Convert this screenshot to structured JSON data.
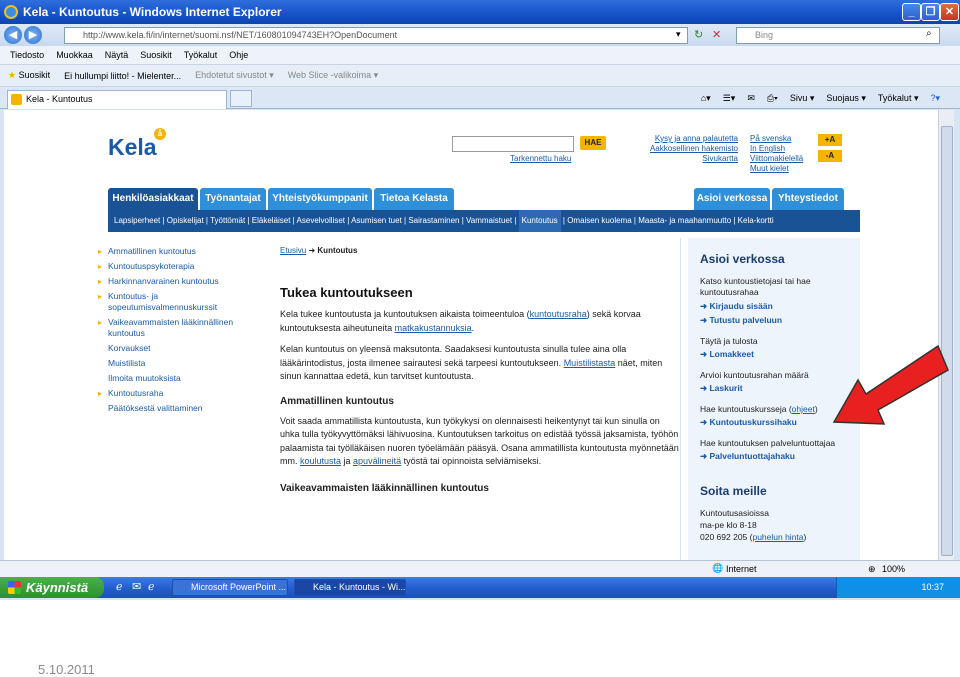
{
  "window": {
    "title": "Kela - Kuntoutus - Windows Internet Explorer",
    "url": "http://www.kela.fi/in/internet/suomi.nsf/NET/160801094743EH?OpenDocument",
    "search_placeholder": "Bing"
  },
  "menubar": [
    "Tiedosto",
    "Muokkaa",
    "Näytä",
    "Suosikit",
    "Työkalut",
    "Ohje"
  ],
  "favbar": {
    "favorites": "Suosikit",
    "items": [
      "Ei hullumpi liitto! - Mielenter...",
      "Ehdotetut sivustot ▾",
      "Web Slice -valikoima ▾"
    ]
  },
  "tab": {
    "title": "Kela - Kuntoutus"
  },
  "commandbar": [
    "Sivu ▾",
    "Suojaus ▾",
    "Työkalut ▾"
  ],
  "site": {
    "logo": "Kela",
    "logo_badge": "å",
    "search_button": "HAE",
    "advanced_search": "Tarkennettu haku",
    "quick_links": [
      "Kysy ja anna palautetta",
      "Aakkosellinen hakemisto",
      "Sivukartta"
    ],
    "lang_links": [
      "På svenska",
      "In English",
      "Viittomakielellä",
      "Muut kielet"
    ],
    "font_larger": "+A",
    "font_smaller": "-A",
    "main_tabs": [
      "Henkilöasiakkaat",
      "Työnantajat",
      "Yhteistyökumppanit",
      "Tietoa Kelasta",
      "Asioi verkossa",
      "Yhteystiedot"
    ],
    "nav_items": [
      "Lapsiperheet",
      "Opiskelijat",
      "Työttömät",
      "Eläkeläiset",
      "Asevelvolliset",
      "Asumisen tuet",
      "Sairastaminen",
      "Vammaistuet",
      "Kuntoutus",
      "Omaisen kuolema",
      "Maasta- ja maahanmuutto",
      "Kela-kortti"
    ],
    "left_nav": [
      {
        "label": "Ammatillinen kuntoutus",
        "bullet": true
      },
      {
        "label": "Kuntoutuspsykoterapia",
        "bullet": true
      },
      {
        "label": "Harkinnanvarainen kuntoutus",
        "bullet": true
      },
      {
        "label": "Kuntoutus- ja sopeutumisvalmennuskurssit",
        "bullet": true
      },
      {
        "label": "Vaikeavammaisten lääkinnällinen kuntoutus",
        "bullet": true
      },
      {
        "label": "Korvaukset",
        "bullet": false
      },
      {
        "label": "Muistilista",
        "bullet": false
      },
      {
        "label": "Ilmoita muutoksista",
        "bullet": false
      },
      {
        "label": "Kuntoutusraha",
        "bullet": true
      },
      {
        "label": "Päätöksestä valittaminen",
        "bullet": false
      }
    ],
    "breadcrumb": {
      "home": "Etusivu",
      "current": "Kuntoutus"
    },
    "heading": "Tukea kuntoutukseen",
    "p1_a": "Kela tukee kuntoutusta ja kuntoutuksen aikaista toimeentuloa (",
    "p1_link": "kuntoutusraha",
    "p1_b": ") sekä korvaa kuntoutuksesta aiheutuneita ",
    "p1_link2": "matkakustannuksia",
    "p1_c": ".",
    "p2": "Kelan kuntoutus on yleensä maksutonta. Saadaksesi kuntoutusta sinulla tulee aina olla lääkärintodistus, josta ilmenee sairautesi sekä tarpeesi kuntoutukseen.",
    "p2_link": "Muistilistasta",
    "p2_b": " näet, miten sinun kannattaa edetä, kun tarvitset kuntoutusta.",
    "h2_1": "Ammatillinen kuntoutus",
    "p3": "Voit saada ammatillista kuntoutusta, kun työkykysi on olennaisesti heikentynyt tai kun sinulla on uhka tulla työkyvyttömäksi lähivuosina. Kuntoutuksen tarkoitus on edistää työssä jaksamista, työhön palaamista tai työlläkäisen nuoren työelämään pääsyä. Osana ammatillista kuntoutusta myönnetään mm. ",
    "p3_link": "koulutusta",
    "p3_b": " ja ",
    "p3_link2": "apuvälineitä",
    "p3_c": " työstä tai opinnoista selviämiseksi.",
    "h2_2": "Vaikeavammaisten lääkinnällinen kuntoutus",
    "right": {
      "heading": "Asioi verkossa",
      "t1": "Katso kuntoustietojasi tai hae kuntoutusrahaa",
      "a1": "Kirjaudu sisään",
      "a2": "Tutustu palveluun",
      "t2": "Täytä ja tulosta",
      "a3": "Lomakkeet",
      "t3": "Arvioi kuntoutusrahan määrä",
      "a4": "Laskurit",
      "t4": "Hae kuntoutuskursseja (",
      "t4_link": "ohjeet",
      "t4_b": ")",
      "a5": "Kuntoutuskurssihaku",
      "t5": "Hae kuntoutuksen palveluntuottajaa",
      "a6": "Palveluntuottajahaku",
      "heading2": "Soita meille",
      "t6": "Kuntoutusasioissa",
      "t7": "ma-pe klo 8-18",
      "t8": "020 692 205 (",
      "t8_link": "puhelun hinta",
      "t8_b": ")"
    }
  },
  "status": {
    "zone": "Internet",
    "zoom": "100%"
  },
  "taskbar": {
    "start": "Käynnistä",
    "items": [
      "Microsoft PowerPoint ...",
      "Kela - Kuntoutus - Wi..."
    ],
    "clock": "10:37"
  },
  "footer_date": "5.10.2011",
  "colors": {
    "kela_blue": "#1a5296",
    "tab_blue": "#2f8fd8",
    "accent_yellow": "#f5b400",
    "arrow_red": "#e82020"
  }
}
